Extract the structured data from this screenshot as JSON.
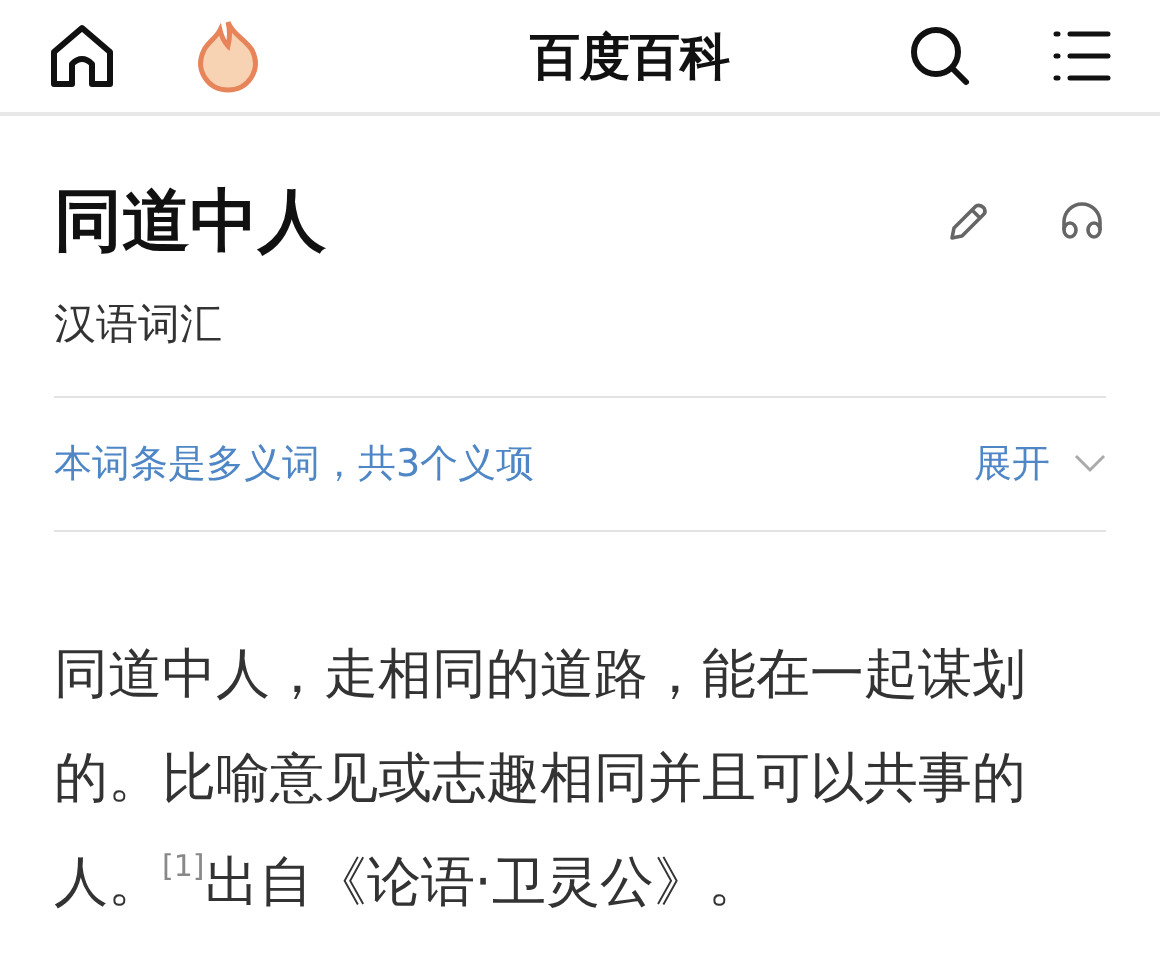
{
  "header": {
    "title": "百度百科"
  },
  "entry": {
    "title": "同道中人",
    "subtitle": "汉语词汇"
  },
  "polysemy": {
    "text": "本词条是多义词，共3个义项",
    "expand": "展开"
  },
  "paragraph": "同道中人，走相同的道路，能在一起谋划的。比喻意见或志趣相同并且可以共事的人。$^{[1]}$出自《论语·卫灵公》。"
}
